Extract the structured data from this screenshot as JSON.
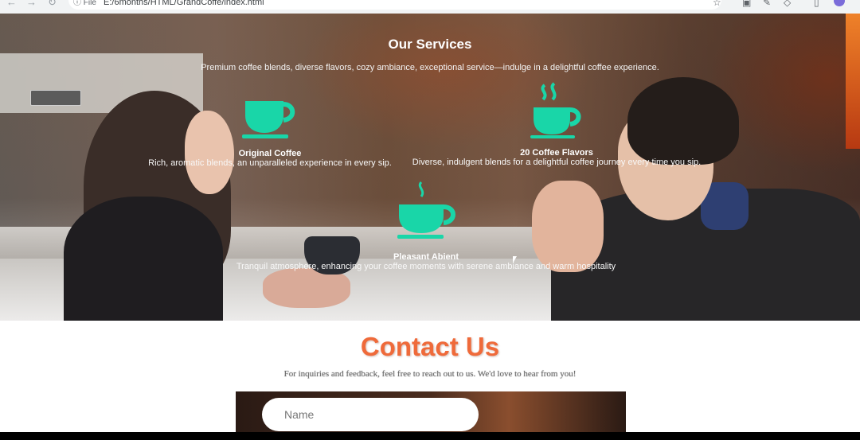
{
  "browser": {
    "info_label": "File",
    "url": "E:/6months/HTML/GrandCoffe/index.html"
  },
  "services": {
    "title": "Our Services",
    "subtitle": "Premium coffee blends, diverse flavors, cozy ambiance, exceptional service—indulge in a delightful coffee experience.",
    "items": [
      {
        "name": "Original Coffee",
        "description": "Rich, aromatic blends, an unparalleled experience in every sip.",
        "icon": "coffee-cup-icon"
      },
      {
        "name": "20 Coffee Flavors",
        "description": "Diverse, indulgent blends for a delightful coffee journey every time you sip.",
        "icon": "steaming-coffee-cup-icon"
      },
      {
        "name": "Pleasant Abient",
        "description": "Tranquil atmosphere, enhancing your coffee moments with serene ambiance and warm hospitality",
        "icon": "coffee-cup-steam-icon"
      }
    ],
    "icon_color": "#19d6a8"
  },
  "contact": {
    "title": "Contact Us",
    "subtitle": "For inquiries and feedback, feel free to reach out to us. We'd love to hear from you!",
    "title_color": "#ef6a3a",
    "name_placeholder": "Name"
  }
}
